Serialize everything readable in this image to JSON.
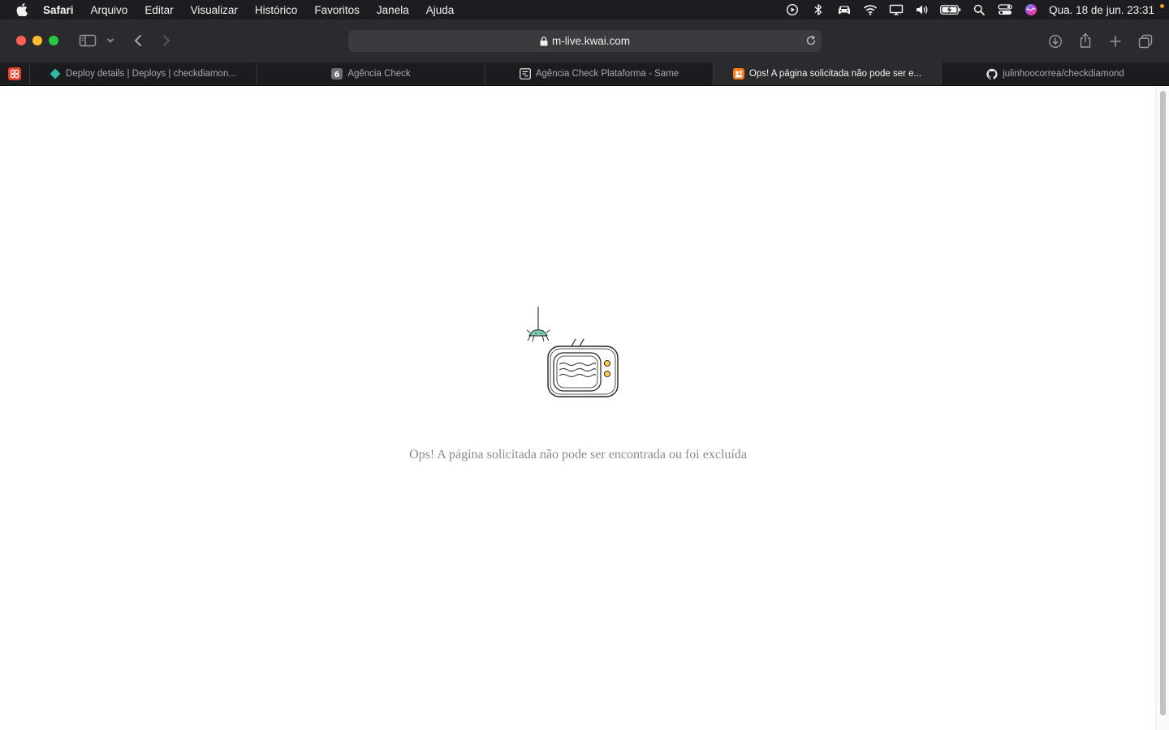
{
  "menubar": {
    "app_name": "Safari",
    "items": [
      "Arquivo",
      "Editar",
      "Visualizar",
      "Histórico",
      "Favoritos",
      "Janela",
      "Ajuda"
    ],
    "status_icons": [
      "play-circle-icon",
      "bluetooth-icon",
      "car-icon",
      "wifi-icon",
      "display-icon",
      "volume-icon",
      "battery-icon",
      "spotlight-icon",
      "control-center-icon",
      "siri-icon"
    ],
    "clock": "Qua. 18 de jun.  23:31"
  },
  "toolbar": {
    "url": "m-live.kwai.com"
  },
  "tabs": [
    {
      "label": "Deploy details | Deploys | checkdiamon...",
      "favicon": "netlify-icon",
      "active": false
    },
    {
      "label": "Agência Check",
      "favicon": "six-badge-icon",
      "active": false
    },
    {
      "label": "Agência Check Plataforma - Same",
      "favicon": "same-logo-icon",
      "active": false
    },
    {
      "label": "Ops! A página solicitada não pode ser e...",
      "favicon": "kwai-icon",
      "active": true
    },
    {
      "label": "julinhoocorrea/checkdiamond",
      "favicon": "github-icon",
      "active": false
    }
  ],
  "page": {
    "message": "Ops! A página solicitada não pode ser encontrada ou foi excluída",
    "illustration": "tv-with-spider-illustration"
  },
  "colors": {
    "menubar_bg": "#1d1d1f",
    "toolbar_bg": "#2b2a2c",
    "tabbar_bg": "#1c1b1d",
    "active_tab_bg": "#2b2a2c",
    "message_text": "#8b8b8b",
    "spider": "#7dd3b0",
    "tv_buttons": "#f5c84c",
    "kwai_orange": "#ff7a1a",
    "pinned_red": "#e8402c"
  }
}
